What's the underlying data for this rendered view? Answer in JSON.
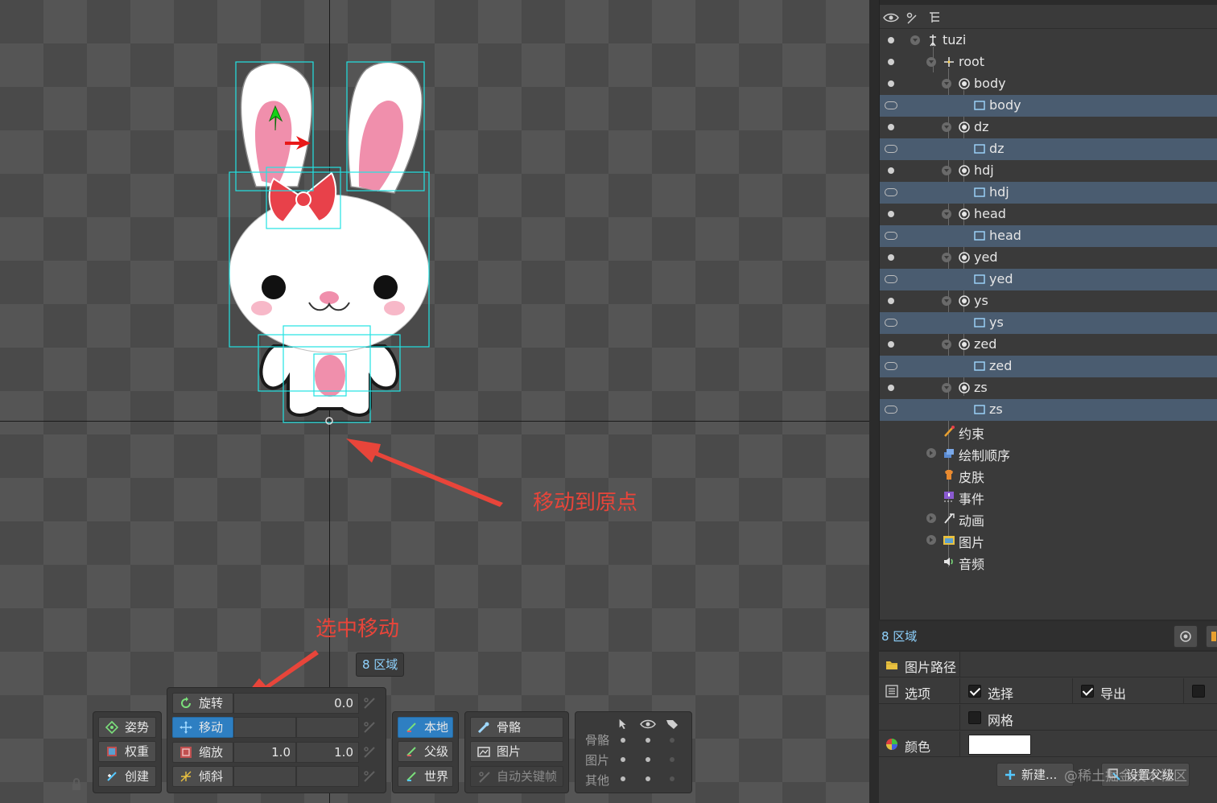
{
  "annotations": {
    "move_to_origin": "移动到原点",
    "select_move": "选中移动"
  },
  "viewport": {
    "region_badge": "8 区域"
  },
  "toolbar": {
    "modes": [
      {
        "label": "姿势",
        "icon": "pose-icon"
      },
      {
        "label": "权重",
        "icon": "weights-icon"
      },
      {
        "label": "创建",
        "icon": "create-icon"
      }
    ],
    "transforms": {
      "rotate": {
        "label": "旋转",
        "value": "0.0"
      },
      "translate": {
        "label": "移动"
      },
      "scale": {
        "label": "缩放",
        "x": "1.0",
        "y": "1.0"
      },
      "shear": {
        "label": "倾斜"
      }
    },
    "axes": [
      {
        "label": "本地",
        "active": true
      },
      {
        "label": "父级"
      },
      {
        "label": "世界"
      }
    ],
    "compensate": [
      {
        "label": "骨骼"
      },
      {
        "label": "图片"
      },
      {
        "label": "自动关键帧",
        "disabled": true
      }
    ],
    "visibility": {
      "rows": [
        "骨骼",
        "图片",
        "其他"
      ]
    }
  },
  "tree": {
    "items": [
      {
        "label": "tuzi",
        "type": "skeleton",
        "depth": 0
      },
      {
        "label": "root",
        "type": "bone",
        "depth": 1
      },
      {
        "label": "body",
        "type": "bone",
        "depth": 2
      },
      {
        "label": "body",
        "type": "attachment",
        "depth": 3,
        "highlight": true
      },
      {
        "label": "dz",
        "type": "bone",
        "depth": 2
      },
      {
        "label": "dz",
        "type": "attachment",
        "depth": 3,
        "highlight": true
      },
      {
        "label": "hdj",
        "type": "bone",
        "depth": 2
      },
      {
        "label": "hdj",
        "type": "attachment",
        "depth": 3,
        "highlight": true
      },
      {
        "label": "head",
        "type": "bone",
        "depth": 2
      },
      {
        "label": "head",
        "type": "attachment",
        "depth": 3,
        "highlight": true
      },
      {
        "label": "yed",
        "type": "bone",
        "depth": 2
      },
      {
        "label": "yed",
        "type": "attachment",
        "depth": 3,
        "highlight": true
      },
      {
        "label": "ys",
        "type": "bone",
        "depth": 2
      },
      {
        "label": "ys",
        "type": "attachment",
        "depth": 3,
        "highlight": true
      },
      {
        "label": "zed",
        "type": "bone",
        "depth": 2
      },
      {
        "label": "zed",
        "type": "attachment",
        "depth": 3,
        "highlight": true
      },
      {
        "label": "zs",
        "type": "bone",
        "depth": 2
      },
      {
        "label": "zs",
        "type": "attachment",
        "depth": 3,
        "highlight": true
      },
      {
        "label": "约束",
        "type": "constraints",
        "depth": 1
      },
      {
        "label": "绘制顺序",
        "type": "draw-order",
        "depth": 1
      },
      {
        "label": "皮肤",
        "type": "skins",
        "depth": 1
      },
      {
        "label": "事件",
        "type": "events",
        "depth": 1
      },
      {
        "label": "动画",
        "type": "animations",
        "depth": 1
      },
      {
        "label": "图片",
        "type": "images",
        "depth": 1
      },
      {
        "label": "音频",
        "type": "audio",
        "depth": 1
      }
    ]
  },
  "status": {
    "text": "8 区域"
  },
  "properties": {
    "image_path": "图片路径",
    "options": "选项",
    "select": "选择",
    "export": "导出",
    "grid": "网格",
    "color": "颜色",
    "color_value": "#ffffff",
    "new_button": "新建...",
    "set_parent_button": "设置父级"
  },
  "watermark": "@稀土掘金技术社区"
}
